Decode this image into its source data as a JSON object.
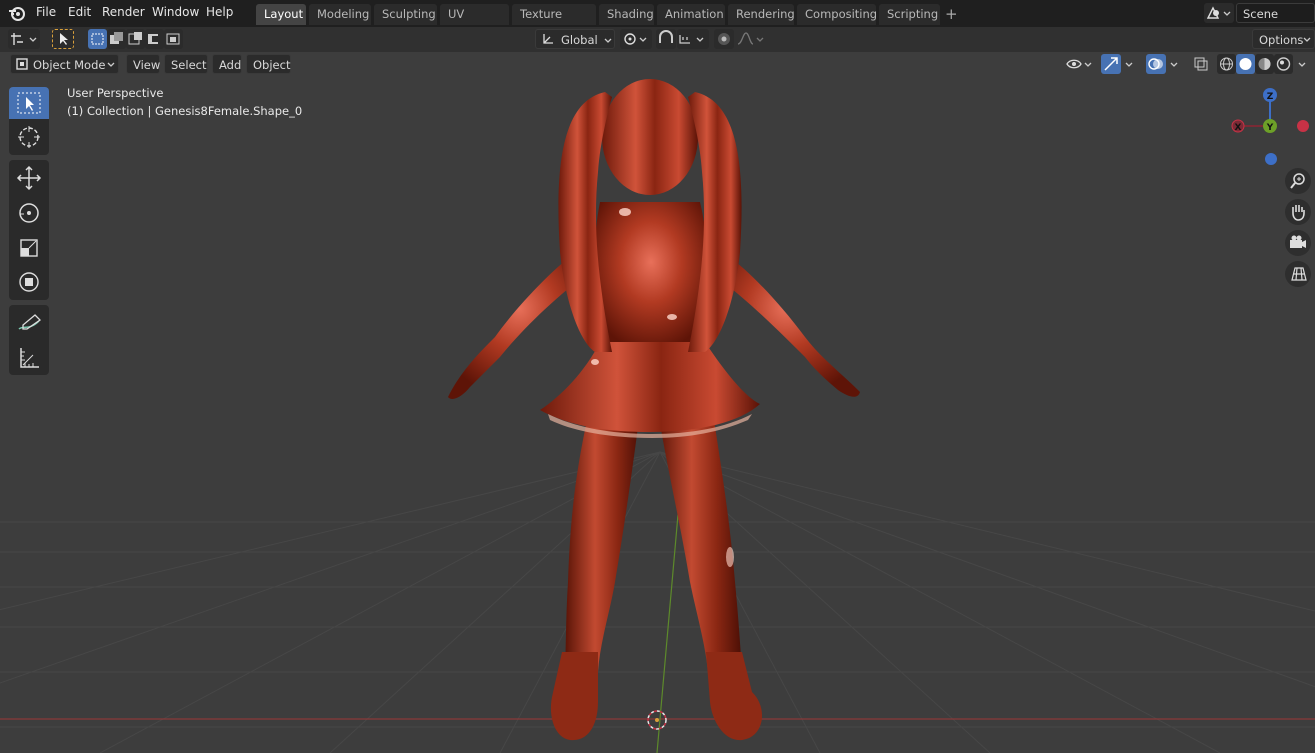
{
  "menu": [
    "File",
    "Edit",
    "Render",
    "Window",
    "Help"
  ],
  "workspaces": [
    "Layout",
    "Modeling",
    "Sculpting",
    "UV Editing",
    "Texture Paint",
    "Shading",
    "Animation",
    "Rendering",
    "Compositing",
    "Scripting"
  ],
  "active_workspace": "Layout",
  "add_workspace_icon": "plus-icon",
  "scene": {
    "label": "Scene"
  },
  "header": {
    "orientation": "Global",
    "options": "Options",
    "mode": "Object Mode",
    "view_menu": [
      "View",
      "Select",
      "Add",
      "Object"
    ]
  },
  "viewport": {
    "perspective": "User Perspective",
    "collection": "(1) Collection | Genesis8Female.Shape_0"
  },
  "gizmo": {
    "z": "Z",
    "y": "Y",
    "x": "X"
  },
  "colors": {
    "accent": "#4772b3",
    "model": "#b23a22",
    "x_axis": "#c83246",
    "y_axis": "#6da028",
    "z_axis": "#3d6fc7"
  }
}
